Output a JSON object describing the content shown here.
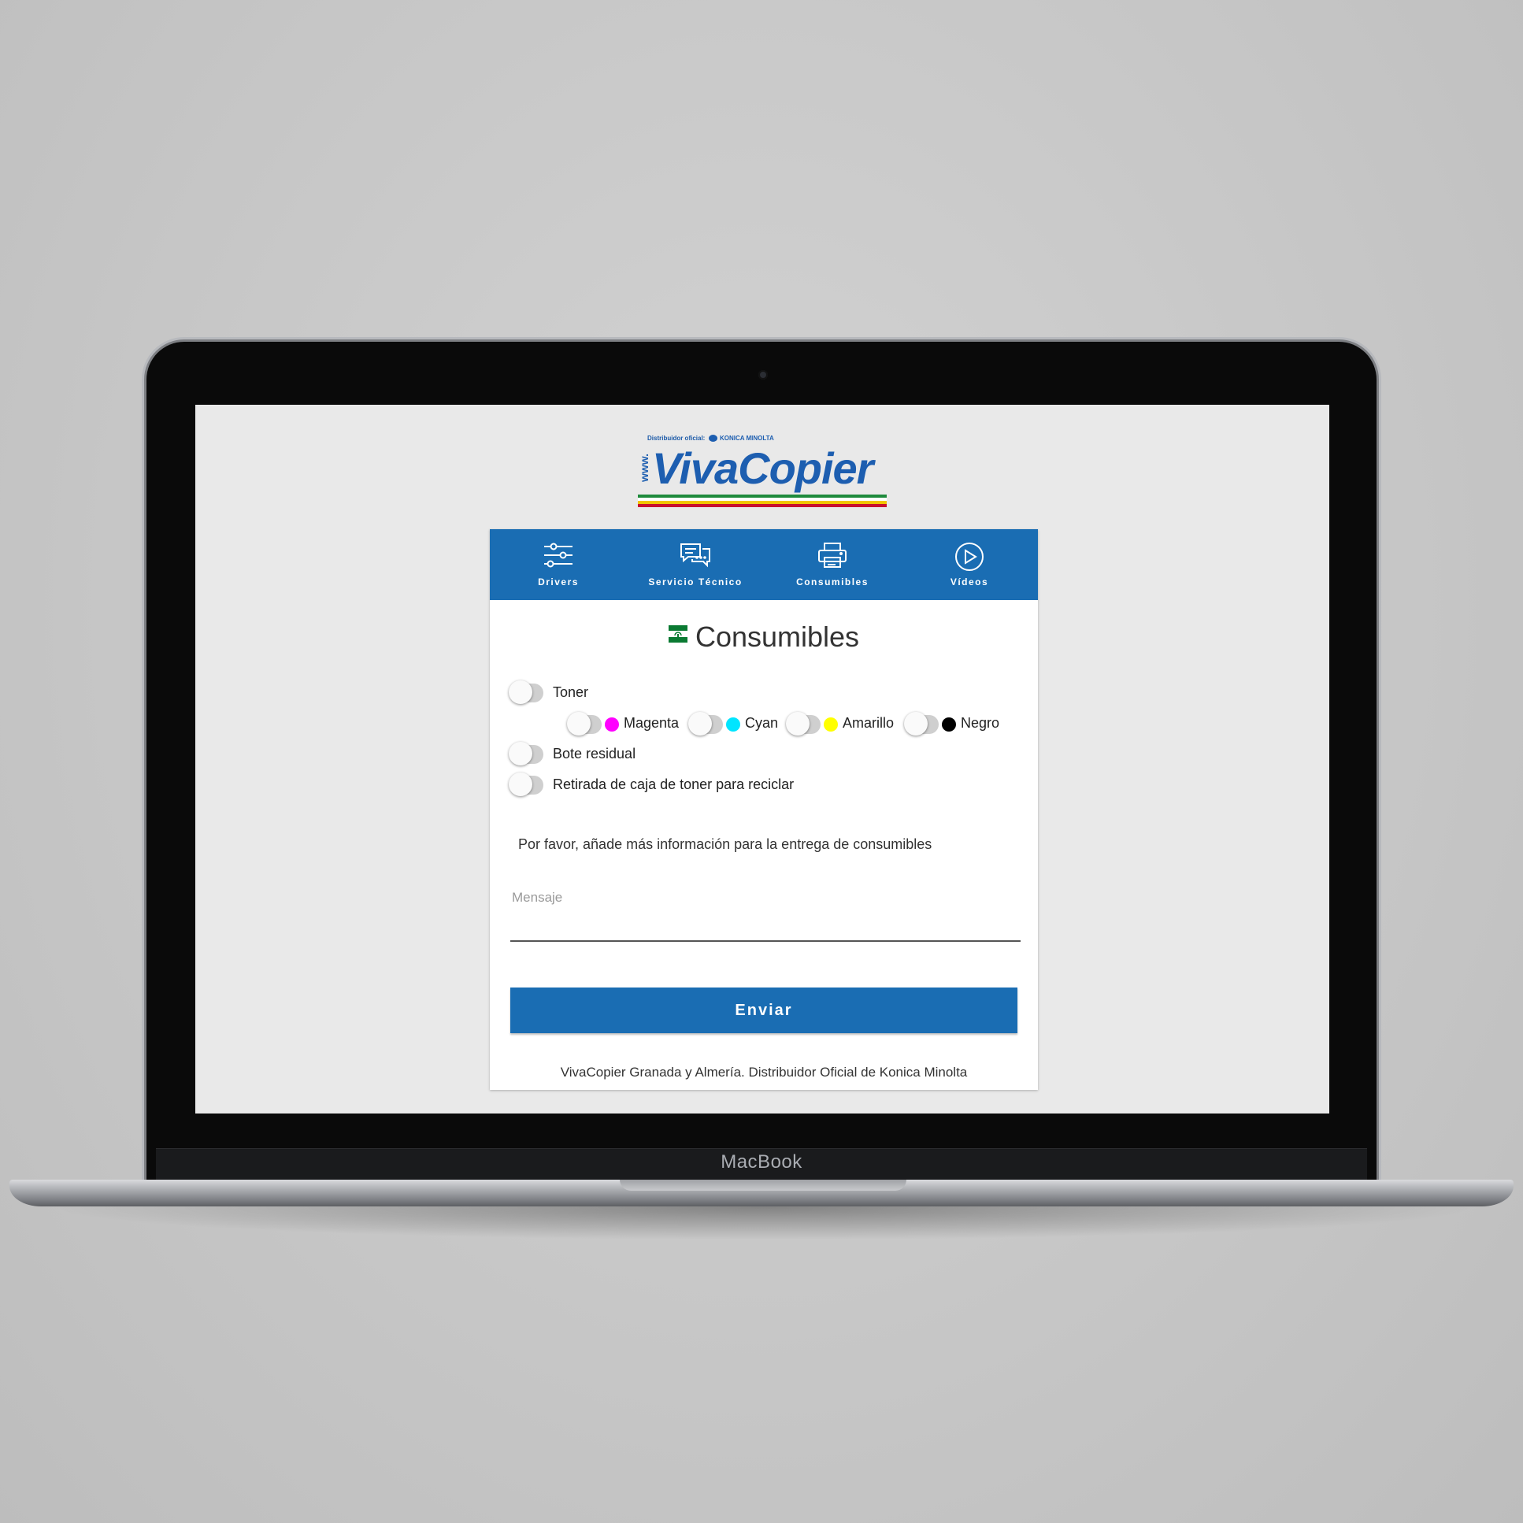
{
  "device": {
    "brand": "MacBook"
  },
  "logo": {
    "tagline": "Distribuidor oficial:",
    "partner": "KONICA MINOLTA",
    "prefix": "www.",
    "name": "VivaCopier"
  },
  "nav": [
    {
      "label": "Drivers",
      "icon": "sliders-icon"
    },
    {
      "label": "Servicio Técnico",
      "icon": "chat-icon"
    },
    {
      "label": "Consumibles",
      "icon": "printer-icon"
    },
    {
      "label": "Vídeos",
      "icon": "play-icon"
    }
  ],
  "page": {
    "title": "Consumibles",
    "flag_icon": "andalucia-flag-icon"
  },
  "options": {
    "toner": {
      "label": "Toner",
      "checked": false
    },
    "colors": [
      {
        "label": "Magenta",
        "color": "#ff00ff",
        "checked": false
      },
      {
        "label": "Cyan",
        "color": "#00e5ff",
        "checked": false
      },
      {
        "label": "Amarillo",
        "color": "#ffff00",
        "checked": false
      },
      {
        "label": "Negro",
        "color": "#000000",
        "checked": false
      }
    ],
    "bote": {
      "label": "Bote residual",
      "checked": false
    },
    "retirada": {
      "label": "Retirada de caja de toner para reciclar",
      "checked": false
    }
  },
  "form": {
    "info": "Por favor, añade más información para la entrega de consumibles",
    "message_label": "Mensaje",
    "message_value": "",
    "submit": "Enviar"
  },
  "footer": "VivaCopier Granada y Almería. Distribuidor Oficial de Konica Minolta",
  "colors": {
    "primary": "#1a6db3",
    "screen_bg": "#e9e9e9"
  }
}
